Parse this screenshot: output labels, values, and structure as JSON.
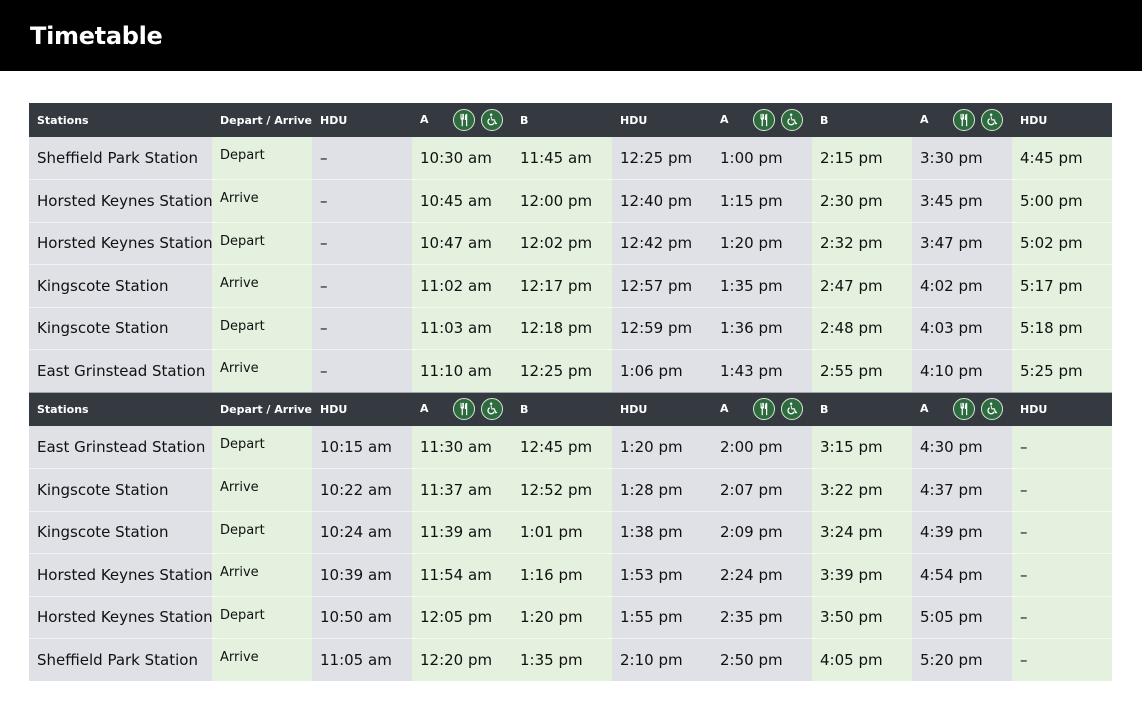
{
  "page": {
    "title": "Timetable"
  },
  "table": {
    "header": {
      "stations": "Stations",
      "depart_arrive": "Depart / Arrive",
      "trains": [
        "HDU",
        "A",
        "B",
        "HDU",
        "A",
        "B",
        "A",
        "HDU"
      ],
      "icons": [
        "fork-knife-icon",
        "wheelchair-icon"
      ]
    },
    "sections": [
      {
        "rows": [
          {
            "station": "Sheffield Park Station",
            "type": "Depart",
            "times": [
              "–",
              "10:30 am",
              "11:45 am",
              "12:25 pm",
              "1:00 pm",
              "2:15 pm",
              "3:30 pm",
              "4:45 pm"
            ]
          },
          {
            "station": "Horsted Keynes Station",
            "type": "Arrive",
            "times": [
              "–",
              "10:45 am",
              "12:00 pm",
              "12:40 pm",
              "1:15 pm",
              "2:30 pm",
              "3:45 pm",
              "5:00 pm"
            ]
          },
          {
            "station": "Horsted Keynes Station",
            "type": "Depart",
            "times": [
              "–",
              "10:47 am",
              "12:02 pm",
              "12:42 pm",
              "1:20 pm",
              "2:32 pm",
              "3:47 pm",
              "5:02 pm"
            ]
          },
          {
            "station": "Kingscote Station",
            "type": "Arrive",
            "times": [
              "–",
              "11:02 am",
              "12:17 pm",
              "12:57 pm",
              "1:35 pm",
              "2:47 pm",
              "4:02 pm",
              "5:17 pm"
            ]
          },
          {
            "station": "Kingscote Station",
            "type": "Depart",
            "times": [
              "–",
              "11:03 am",
              "12:18 pm",
              "12:59 pm",
              "1:36 pm",
              "2:48 pm",
              "4:03 pm",
              "5:18 pm"
            ]
          },
          {
            "station": "East Grinstead Station",
            "type": "Arrive",
            "times": [
              "–",
              "11:10 am",
              "12:25 pm",
              "1:06 pm",
              "1:43 pm",
              "2:55 pm",
              "4:10 pm",
              "5:25 pm"
            ]
          }
        ]
      },
      {
        "rows": [
          {
            "station": "East Grinstead Station",
            "type": "Depart",
            "times": [
              "10:15 am",
              "11:30 am",
              "12:45 pm",
              "1:20 pm",
              "2:00 pm",
              "3:15 pm",
              "4:30 pm",
              "–"
            ]
          },
          {
            "station": "Kingscote Station",
            "type": "Arrive",
            "times": [
              "10:22 am",
              "11:37 am",
              "12:52 pm",
              "1:28 pm",
              "2:07 pm",
              "3:22 pm",
              "4:37 pm",
              "–"
            ]
          },
          {
            "station": "Kingscote Station",
            "type": "Depart",
            "times": [
              "10:24 am",
              "11:39 am",
              "1:01 pm",
              "1:38 pm",
              "2:09 pm",
              "3:24 pm",
              "4:39 pm",
              "–"
            ]
          },
          {
            "station": "Horsted Keynes Station",
            "type": "Arrive",
            "times": [
              "10:39 am",
              "11:54 am",
              "1:16 pm",
              "1:53 pm",
              "2:24 pm",
              "3:39 pm",
              "4:54 pm",
              "–"
            ]
          },
          {
            "station": "Horsted Keynes Station",
            "type": "Depart",
            "times": [
              "10:50 am",
              "12:05 pm",
              "1:20 pm",
              "1:55 pm",
              "2:35 pm",
              "3:50 pm",
              "5:05 pm",
              "–"
            ]
          },
          {
            "station": "Sheffield Park Station",
            "type": "Arrive",
            "times": [
              "11:05 am",
              "12:20 pm",
              "1:35 pm",
              "2:10 pm",
              "2:50 pm",
              "4:05 pm",
              "5:20 pm",
              "–"
            ]
          }
        ]
      }
    ]
  }
}
